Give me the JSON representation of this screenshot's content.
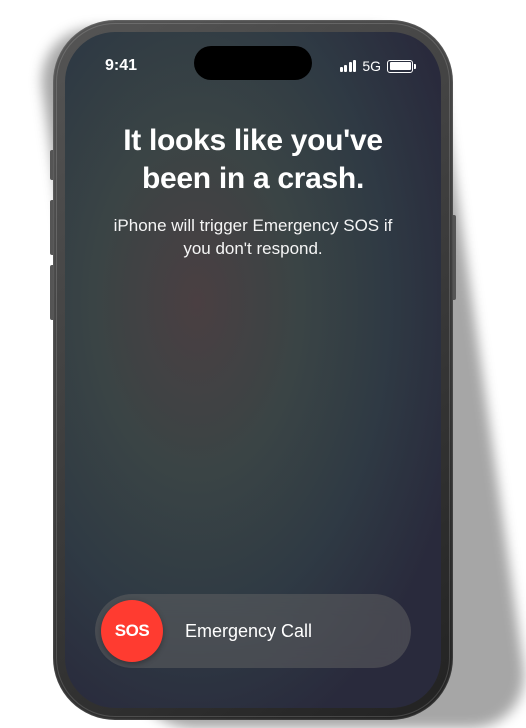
{
  "statusBar": {
    "time": "9:41",
    "network": "5G"
  },
  "crash": {
    "heading": "It looks like you've been in a crash.",
    "subtext": "iPhone will trigger Emergency SOS if you don't respond."
  },
  "slider": {
    "knob": "SOS",
    "label": "Emergency Call"
  },
  "colors": {
    "sosRed": "#ff3b30"
  }
}
